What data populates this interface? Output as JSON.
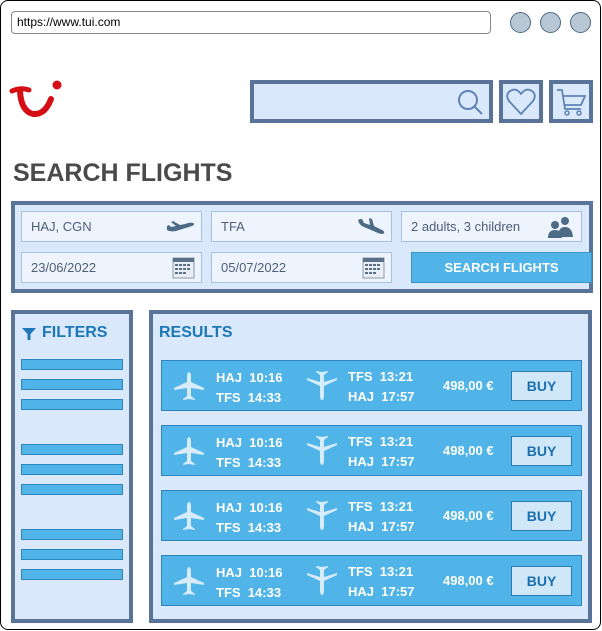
{
  "browser": {
    "url": "https://www.tui.com",
    "window_buttons": [
      "minimize",
      "maximize",
      "close"
    ]
  },
  "header": {
    "logo": "tui-logo",
    "search": {
      "value": "",
      "placeholder": "",
      "icon": "search-icon"
    },
    "wishlist_icon": "heart-icon",
    "cart_icon": "cart-icon"
  },
  "page": {
    "title": "SEARCH FLIGHTS"
  },
  "search_form": {
    "departure": {
      "value": "HAJ, CGN",
      "icon": "plane-takeoff-icon"
    },
    "destination": {
      "value": "TFA",
      "icon": "plane-landing-icon"
    },
    "travelers": {
      "value": "2 adults, 3 children",
      "icon": "people-icon"
    },
    "depart_date": {
      "value": "23/06/2022",
      "icon": "calendar-icon"
    },
    "return_date": {
      "value": "05/07/2022",
      "icon": "calendar-icon"
    },
    "submit_label": "SEARCH FLIGHTS"
  },
  "filters": {
    "title": "FILTERS",
    "icon": "filter-icon",
    "groups": [
      [
        "",
        "",
        ""
      ],
      [
        "",
        "",
        ""
      ],
      [
        "",
        "",
        ""
      ]
    ]
  },
  "results": {
    "title": "RESULTS",
    "items": [
      {
        "out_from": "HAJ",
        "out_dep": "10:16",
        "out_to": "TFS",
        "out_arr": "14:33",
        "ret_from": "TFS",
        "ret_dep": "13:21",
        "ret_to": "HAJ",
        "ret_arr": "17:57",
        "price": "498,00 €",
        "buy_label": "BUY"
      },
      {
        "out_from": "HAJ",
        "out_dep": "10:16",
        "out_to": "TFS",
        "out_arr": "14:33",
        "ret_from": "TFS",
        "ret_dep": "13:21",
        "ret_to": "HAJ",
        "ret_arr": "17:57",
        "price": "498,00 €",
        "buy_label": "BUY"
      },
      {
        "out_from": "HAJ",
        "out_dep": "10:16",
        "out_to": "TFS",
        "out_arr": "14:33",
        "ret_from": "TFS",
        "ret_dep": "13:21",
        "ret_to": "HAJ",
        "ret_arr": "17:57",
        "price": "498,00 €",
        "buy_label": "BUY"
      },
      {
        "out_from": "HAJ",
        "out_dep": "10:16",
        "out_to": "TFS",
        "out_arr": "14:33",
        "ret_from": "TFS",
        "ret_dep": "13:21",
        "ret_to": "HAJ",
        "ret_arr": "17:57",
        "price": "498,00 €",
        "buy_label": "BUY"
      }
    ]
  },
  "colors": {
    "brand_red": "#d40e14",
    "panel_fill": "#dae8fc",
    "panel_border": "#5a7398",
    "accent_blue": "#50b4e8",
    "title_blue": "#1b77b5"
  }
}
